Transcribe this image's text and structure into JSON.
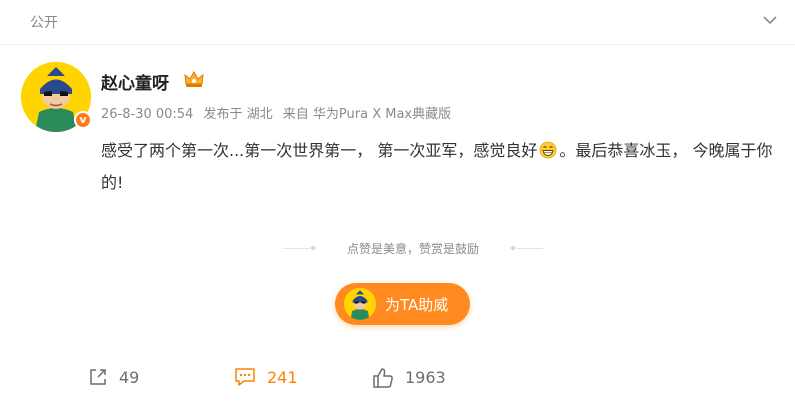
{
  "header": {
    "visibility_label": "公开",
    "collapse_icon": "chevron-down-icon"
  },
  "post": {
    "author": {
      "name": "赵心童呀",
      "badge_icon": "crown-icon",
      "verified_icon": "verified-v-icon",
      "verified_label": "v"
    },
    "meta": {
      "time": "26-8-30 00:54",
      "location": "发布于 湖北",
      "source": "来自 华为Pura X Max典藏版"
    },
    "content": {
      "part1": "感受了两个第一次...第一次世界第一， 第一次亚军，感觉良好",
      "emoji": "grin-emoji-icon",
      "part2": "。最后恭喜冰玉， 今晚属于你的!"
    }
  },
  "reward": {
    "prompt": "点赞是美意，赞赏是鼓励",
    "button_label": "为TA助威"
  },
  "actions": {
    "repost": {
      "icon": "share-icon",
      "count": "49"
    },
    "comment": {
      "icon": "comment-icon",
      "count": "241"
    },
    "like": {
      "icon": "thumbs-up-icon",
      "count": "1963"
    }
  },
  "colors": {
    "accent": "#ff8a1f",
    "comment_active": "#ff8200",
    "meta_text": "#8a8a8a"
  }
}
